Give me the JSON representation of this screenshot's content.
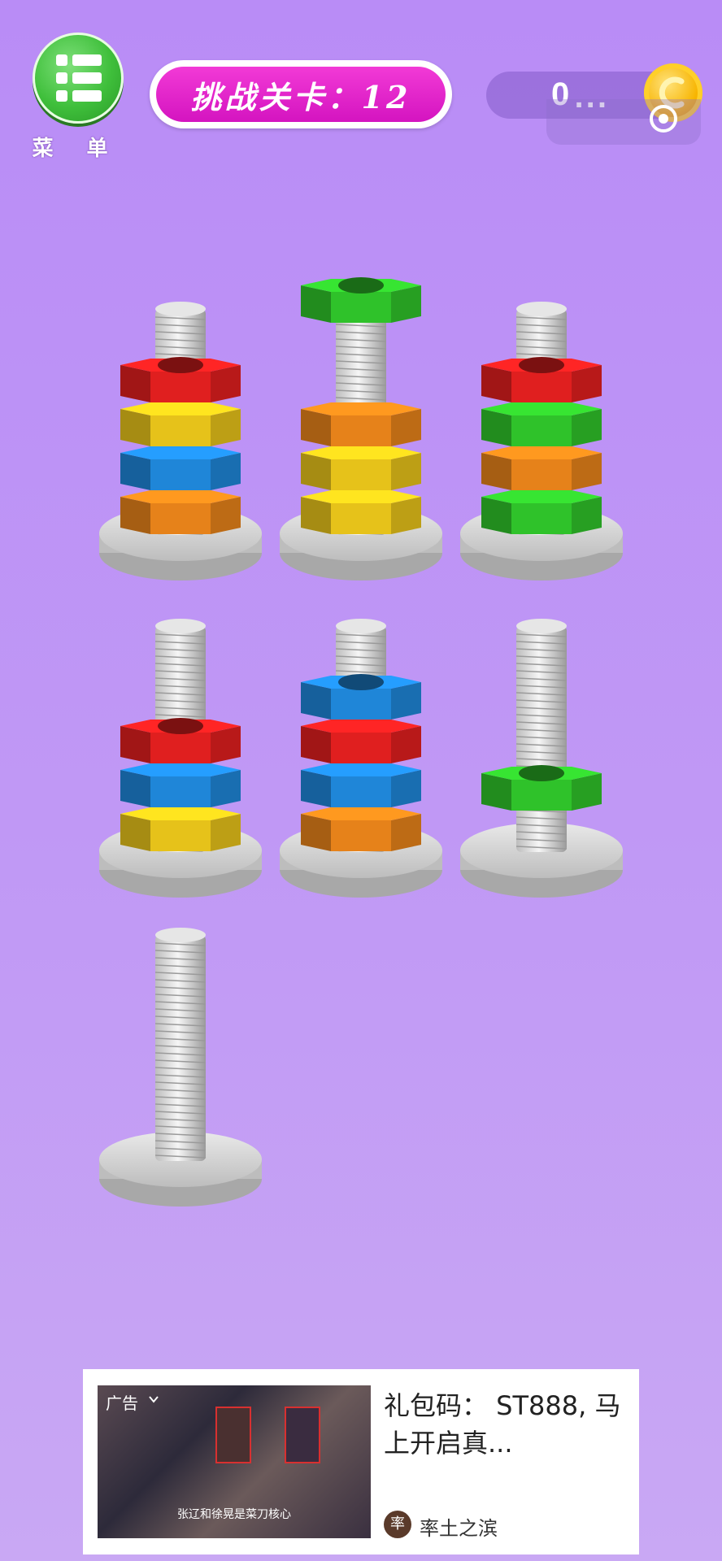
{
  "menu": {
    "label": "菜 单",
    "icon": "list-icon"
  },
  "level": {
    "text": "挑战关卡：12"
  },
  "coins": {
    "value": "0",
    "dots": "...",
    "icon": "coin-icon",
    "settings_icon": "settings-icon"
  },
  "board": {
    "poles": [
      {
        "name": "pole-1",
        "nuts": [
          "orange",
          "blue",
          "yellow",
          "red"
        ]
      },
      {
        "name": "pole-2",
        "nuts": [
          "yellow",
          "yellow",
          "orange",
          "green"
        ],
        "lifted_top": true
      },
      {
        "name": "pole-3",
        "nuts": [
          "green",
          "orange",
          "green",
          "red"
        ]
      },
      {
        "name": "pole-4",
        "nuts": [
          "yellow",
          "blue",
          "red"
        ]
      },
      {
        "name": "pole-5",
        "nuts": [
          "orange",
          "blue",
          "red",
          "blue"
        ]
      },
      {
        "name": "pole-6",
        "nuts": [
          "green"
        ],
        "lifted_top": true
      },
      {
        "name": "pole-7",
        "nuts": []
      }
    ],
    "colors": {
      "red": "#e01f1f",
      "yellow": "#e6c21a",
      "blue": "#1f86d8",
      "orange": "#e6821a",
      "green": "#2fc22a"
    }
  },
  "ad": {
    "tag": "广告",
    "title": "礼包码： ST888, 马上开启真...",
    "thumb_caption": "张辽和徐晃是菜刀核心",
    "source": "率土之滨",
    "source_avatar_char": "率"
  }
}
